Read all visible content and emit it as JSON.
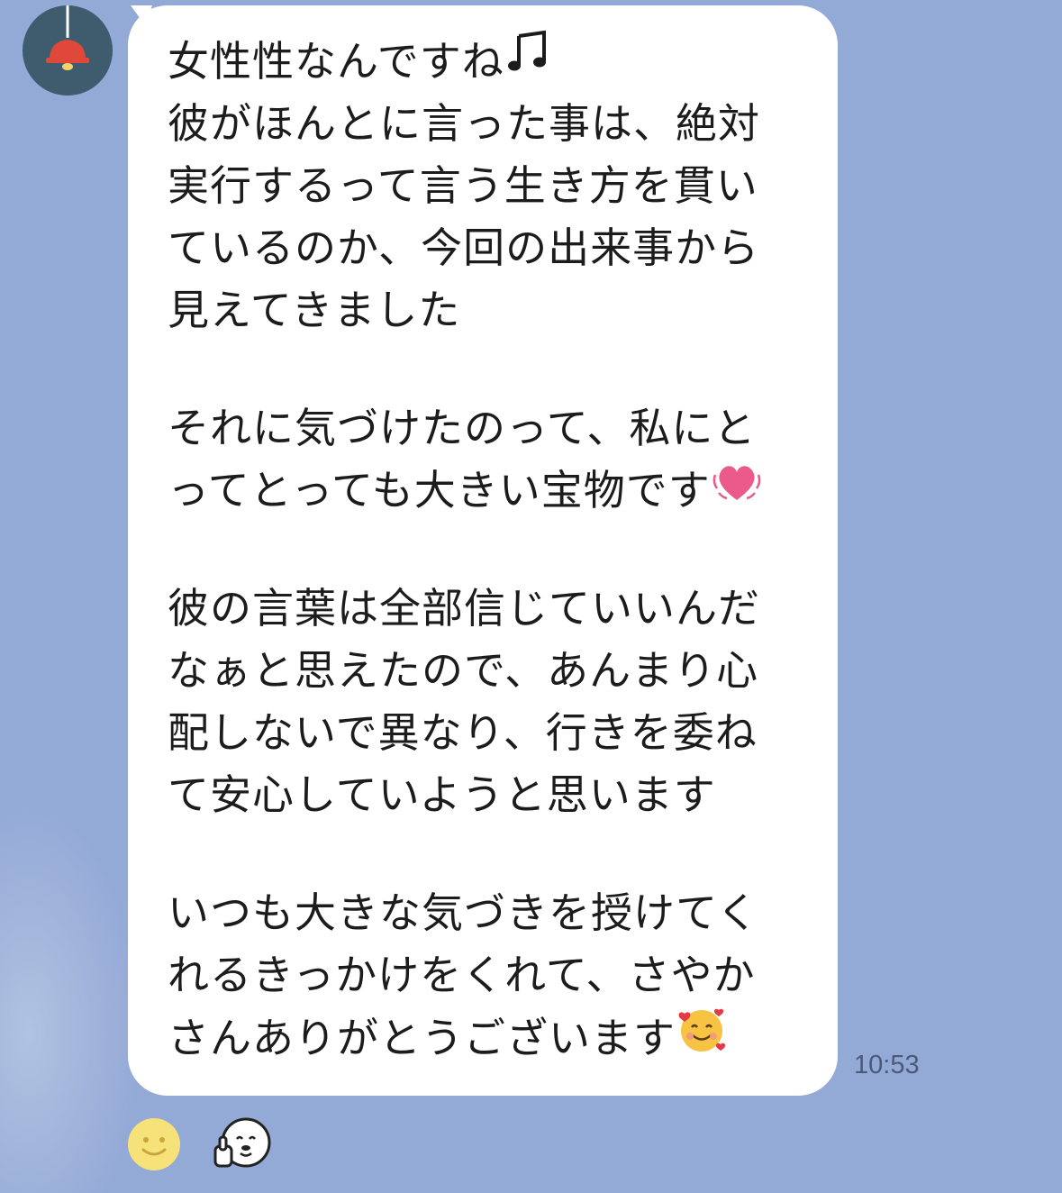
{
  "chat": {
    "avatar_icon": "pendant-lamp-icon",
    "message": {
      "paragraphs": [
        {
          "lines": [
            {
              "text": "女性性なんですね",
              "trailing_icon": "music-note-icon"
            },
            {
              "text": "彼がほんとに言った事は、絶対"
            },
            {
              "text": "実行するって言う生き方を貫い"
            },
            {
              "text": "ているのか、今回の出来事から"
            },
            {
              "text": "見えてきました"
            }
          ]
        },
        {
          "lines": [
            {
              "text": "それに気づけたのって、私にと"
            },
            {
              "text": "ってとっても大きい宝物です",
              "trailing_icon": "beating-heart-icon"
            }
          ]
        },
        {
          "lines": [
            {
              "text": "彼の言葉は全部信じていいんだ"
            },
            {
              "text": "なぁと思えたので、あんまり心"
            },
            {
              "text": "配しないで異なり、行きを委ね"
            },
            {
              "text": "て安心していようと思います"
            }
          ]
        },
        {
          "lines": [
            {
              "text": "いつも大きな気づきを授けてく"
            },
            {
              "text": "れるきっかけをくれて、さやか"
            },
            {
              "text": "さんありがとうございます",
              "trailing_icon": "smiling-face-with-hearts-icon"
            }
          ]
        }
      ],
      "time": "10:53"
    },
    "reactions": [
      {
        "icon": "smiley-reaction-icon"
      },
      {
        "icon": "thumbs-up-sticker-icon"
      }
    ],
    "colors": {
      "background": "#93a9d6",
      "bubble": "#ffffff",
      "text": "#1c1c1c",
      "time": "#4b5a78",
      "avatar": "#3f5c6e",
      "lamp": "#e0483a",
      "heart": "#ec5a8c",
      "smiley": "#f7e27a"
    }
  }
}
